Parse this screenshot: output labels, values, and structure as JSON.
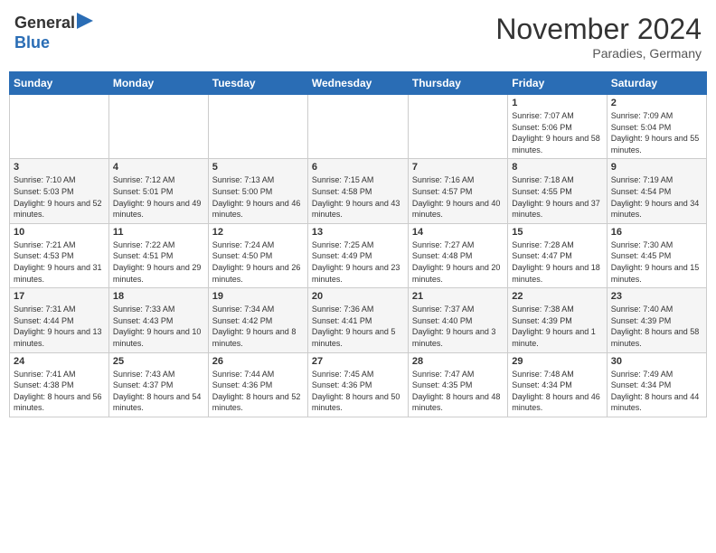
{
  "header": {
    "logo_general": "General",
    "logo_blue": "Blue",
    "month_title": "November 2024",
    "location": "Paradies, Germany"
  },
  "days_of_week": [
    "Sunday",
    "Monday",
    "Tuesday",
    "Wednesday",
    "Thursday",
    "Friday",
    "Saturday"
  ],
  "weeks": [
    [
      {
        "day": "",
        "info": ""
      },
      {
        "day": "",
        "info": ""
      },
      {
        "day": "",
        "info": ""
      },
      {
        "day": "",
        "info": ""
      },
      {
        "day": "",
        "info": ""
      },
      {
        "day": "1",
        "info": "Sunrise: 7:07 AM\nSunset: 5:06 PM\nDaylight: 9 hours and 58 minutes."
      },
      {
        "day": "2",
        "info": "Sunrise: 7:09 AM\nSunset: 5:04 PM\nDaylight: 9 hours and 55 minutes."
      }
    ],
    [
      {
        "day": "3",
        "info": "Sunrise: 7:10 AM\nSunset: 5:03 PM\nDaylight: 9 hours and 52 minutes."
      },
      {
        "day": "4",
        "info": "Sunrise: 7:12 AM\nSunset: 5:01 PM\nDaylight: 9 hours and 49 minutes."
      },
      {
        "day": "5",
        "info": "Sunrise: 7:13 AM\nSunset: 5:00 PM\nDaylight: 9 hours and 46 minutes."
      },
      {
        "day": "6",
        "info": "Sunrise: 7:15 AM\nSunset: 4:58 PM\nDaylight: 9 hours and 43 minutes."
      },
      {
        "day": "7",
        "info": "Sunrise: 7:16 AM\nSunset: 4:57 PM\nDaylight: 9 hours and 40 minutes."
      },
      {
        "day": "8",
        "info": "Sunrise: 7:18 AM\nSunset: 4:55 PM\nDaylight: 9 hours and 37 minutes."
      },
      {
        "day": "9",
        "info": "Sunrise: 7:19 AM\nSunset: 4:54 PM\nDaylight: 9 hours and 34 minutes."
      }
    ],
    [
      {
        "day": "10",
        "info": "Sunrise: 7:21 AM\nSunset: 4:53 PM\nDaylight: 9 hours and 31 minutes."
      },
      {
        "day": "11",
        "info": "Sunrise: 7:22 AM\nSunset: 4:51 PM\nDaylight: 9 hours and 29 minutes."
      },
      {
        "day": "12",
        "info": "Sunrise: 7:24 AM\nSunset: 4:50 PM\nDaylight: 9 hours and 26 minutes."
      },
      {
        "day": "13",
        "info": "Sunrise: 7:25 AM\nSunset: 4:49 PM\nDaylight: 9 hours and 23 minutes."
      },
      {
        "day": "14",
        "info": "Sunrise: 7:27 AM\nSunset: 4:48 PM\nDaylight: 9 hours and 20 minutes."
      },
      {
        "day": "15",
        "info": "Sunrise: 7:28 AM\nSunset: 4:47 PM\nDaylight: 9 hours and 18 minutes."
      },
      {
        "day": "16",
        "info": "Sunrise: 7:30 AM\nSunset: 4:45 PM\nDaylight: 9 hours and 15 minutes."
      }
    ],
    [
      {
        "day": "17",
        "info": "Sunrise: 7:31 AM\nSunset: 4:44 PM\nDaylight: 9 hours and 13 minutes."
      },
      {
        "day": "18",
        "info": "Sunrise: 7:33 AM\nSunset: 4:43 PM\nDaylight: 9 hours and 10 minutes."
      },
      {
        "day": "19",
        "info": "Sunrise: 7:34 AM\nSunset: 4:42 PM\nDaylight: 9 hours and 8 minutes."
      },
      {
        "day": "20",
        "info": "Sunrise: 7:36 AM\nSunset: 4:41 PM\nDaylight: 9 hours and 5 minutes."
      },
      {
        "day": "21",
        "info": "Sunrise: 7:37 AM\nSunset: 4:40 PM\nDaylight: 9 hours and 3 minutes."
      },
      {
        "day": "22",
        "info": "Sunrise: 7:38 AM\nSunset: 4:39 PM\nDaylight: 9 hours and 1 minute."
      },
      {
        "day": "23",
        "info": "Sunrise: 7:40 AM\nSunset: 4:39 PM\nDaylight: 8 hours and 58 minutes."
      }
    ],
    [
      {
        "day": "24",
        "info": "Sunrise: 7:41 AM\nSunset: 4:38 PM\nDaylight: 8 hours and 56 minutes."
      },
      {
        "day": "25",
        "info": "Sunrise: 7:43 AM\nSunset: 4:37 PM\nDaylight: 8 hours and 54 minutes."
      },
      {
        "day": "26",
        "info": "Sunrise: 7:44 AM\nSunset: 4:36 PM\nDaylight: 8 hours and 52 minutes."
      },
      {
        "day": "27",
        "info": "Sunrise: 7:45 AM\nSunset: 4:36 PM\nDaylight: 8 hours and 50 minutes."
      },
      {
        "day": "28",
        "info": "Sunrise: 7:47 AM\nSunset: 4:35 PM\nDaylight: 8 hours and 48 minutes."
      },
      {
        "day": "29",
        "info": "Sunrise: 7:48 AM\nSunset: 4:34 PM\nDaylight: 8 hours and 46 minutes."
      },
      {
        "day": "30",
        "info": "Sunrise: 7:49 AM\nSunset: 4:34 PM\nDaylight: 8 hours and 44 minutes."
      }
    ]
  ]
}
